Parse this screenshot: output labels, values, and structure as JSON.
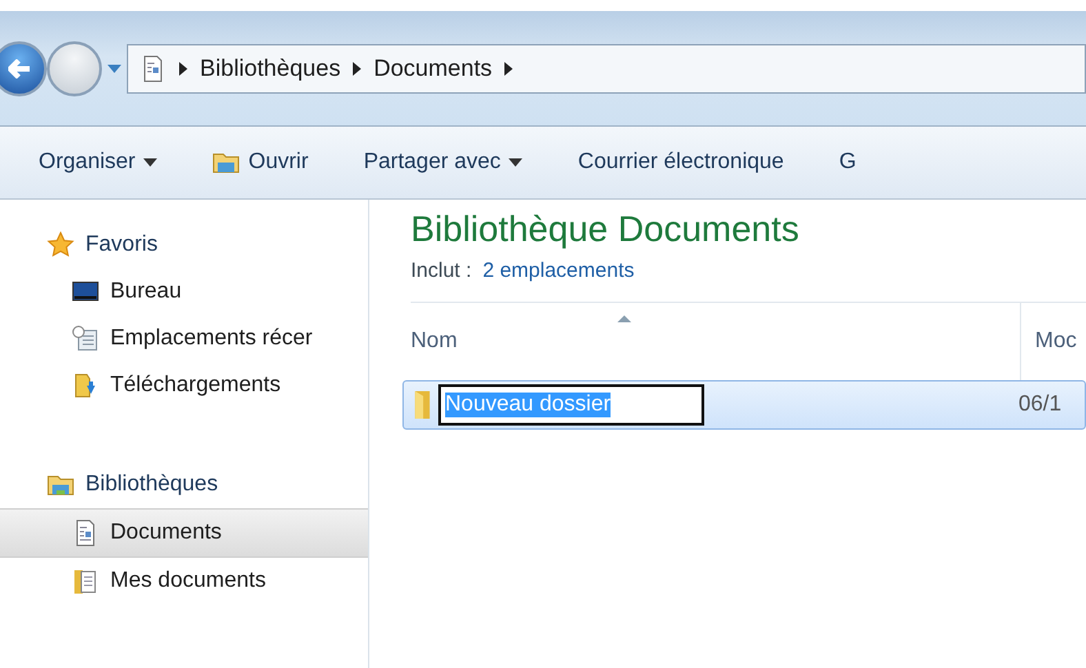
{
  "address_bar": {
    "breadcrumbs": [
      "Bibliothèques",
      "Documents"
    ]
  },
  "toolbar": [
    {
      "label": "Organiser",
      "kind": "dropdown"
    },
    {
      "label": "Ouvrir",
      "kind": "icon"
    },
    {
      "label": "Partager avec",
      "kind": "dropdown"
    },
    {
      "label": "Courrier électronique",
      "kind": "plain"
    },
    {
      "label": "G",
      "kind": "plain"
    }
  ],
  "sidebar": {
    "groups": [
      {
        "label": "Favoris",
        "kind": "star",
        "selected": false,
        "children": [
          {
            "label": "Bureau",
            "kind": "desktop",
            "selected": false
          },
          {
            "label": "Emplacements récer",
            "kind": "recent",
            "selected": false
          },
          {
            "label": "Téléchargements",
            "kind": "download",
            "selected": false
          }
        ]
      },
      {
        "label": "Bibliothèques",
        "kind": "library",
        "selected": false,
        "children": [
          {
            "label": "Documents",
            "kind": "document",
            "selected": true
          },
          {
            "label": "Mes documents",
            "kind": "docfolder",
            "selected": false
          }
        ]
      }
    ]
  },
  "content": {
    "title": "Bibliothèque Documents",
    "includes_label": "Inclut :",
    "includes_link": "2 emplacements",
    "columns": [
      "Nom",
      "Moc"
    ],
    "rows": [
      {
        "name": "Nouveau dossier",
        "column_2": "06/1",
        "selected": true,
        "editing": true
      }
    ]
  }
}
